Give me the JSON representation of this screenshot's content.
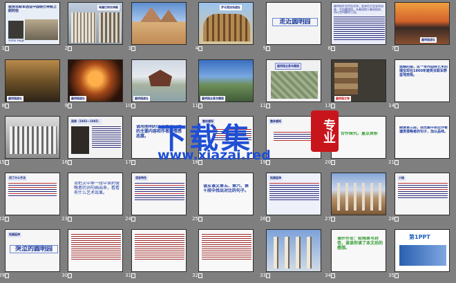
{
  "slides": [
    {
      "num": "1",
      "title": "就英法联军远征中国给巴特勒上尉的信",
      "sub": "Victor Hugo"
    },
    {
      "num": "2",
      "title": "希腊巴特农神殿"
    },
    {
      "num": "3",
      "title": ""
    },
    {
      "num": "4",
      "title": "罗马竞技场遗址"
    },
    {
      "num": "5",
      "title": "走近圆明园"
    },
    {
      "num": "6",
      "title": "圆明园在北京西北郊，是清代大型皇家园林，它由圆明园、长春园和万春园组成，所以也叫圆明三园。"
    },
    {
      "num": "7",
      "title": "圆明园遗址"
    },
    {
      "num": "8",
      "title": "圆明园遗址"
    },
    {
      "num": "9",
      "title": "圆明园遗址"
    },
    {
      "num": "10",
      "title": "圆明园遗址"
    },
    {
      "num": "11",
      "title": "圆明园全景鸟瞰图"
    },
    {
      "num": "12",
      "title": "遗憾的是，这一世界园林艺术的瑰宝却在1860年被英法联军野蛮地焚毁。"
    },
    {
      "num": "15",
      "title": ""
    },
    {
      "num": "16",
      "title": "雨果（1802—1885）"
    },
    {
      "num": "17",
      "title": "请用简明的语言概括文章的主要内容和作者的情感态度。"
    },
    {
      "num": "18",
      "title": "整体感知"
    },
    {
      "num": "19",
      "title": "整体感知"
    },
    {
      "num": "20",
      "title": "合作探究，重点赏析"
    },
    {
      "num": "21",
      "title": "朗读第三段，找出集中表达作者谴责侵略者的句子，加以品味。"
    },
    {
      "num": "22",
      "title": "用了什么手法"
    },
    {
      "num": "23",
      "title": "请把文中第一段中讽刺侵略者的词句画出来，看看有什么艺术效果。"
    },
    {
      "num": "24",
      "title": "语言特色"
    },
    {
      "num": "25",
      "title": "请从课文第五、第六、第十段中找出对比的句子。"
    },
    {
      "num": "26",
      "title": "拓展延伸"
    },
    {
      "num": "27",
      "title": ""
    },
    {
      "num": "28",
      "title": "小结"
    },
    {
      "num": "29",
      "title": "哭泣的圆明园"
    },
    {
      "num": "30",
      "title": ""
    },
    {
      "num": "31",
      "title": ""
    },
    {
      "num": "32",
      "title": ""
    },
    {
      "num": "33",
      "title": ""
    },
    {
      "num": "34",
      "title": "课外作业：给雨果写封信，谈谈你读了本文后的感想。"
    },
    {
      "num": "35",
      "title": "第1PPT"
    }
  ],
  "watermark": {
    "line1": "下载集",
    "line2": "专业",
    "url": "www.xiazai.red"
  },
  "colors": {
    "sorter_bg": "#7f7f7f",
    "watermark": "#1f4fd6",
    "seal": "#c8151b"
  }
}
